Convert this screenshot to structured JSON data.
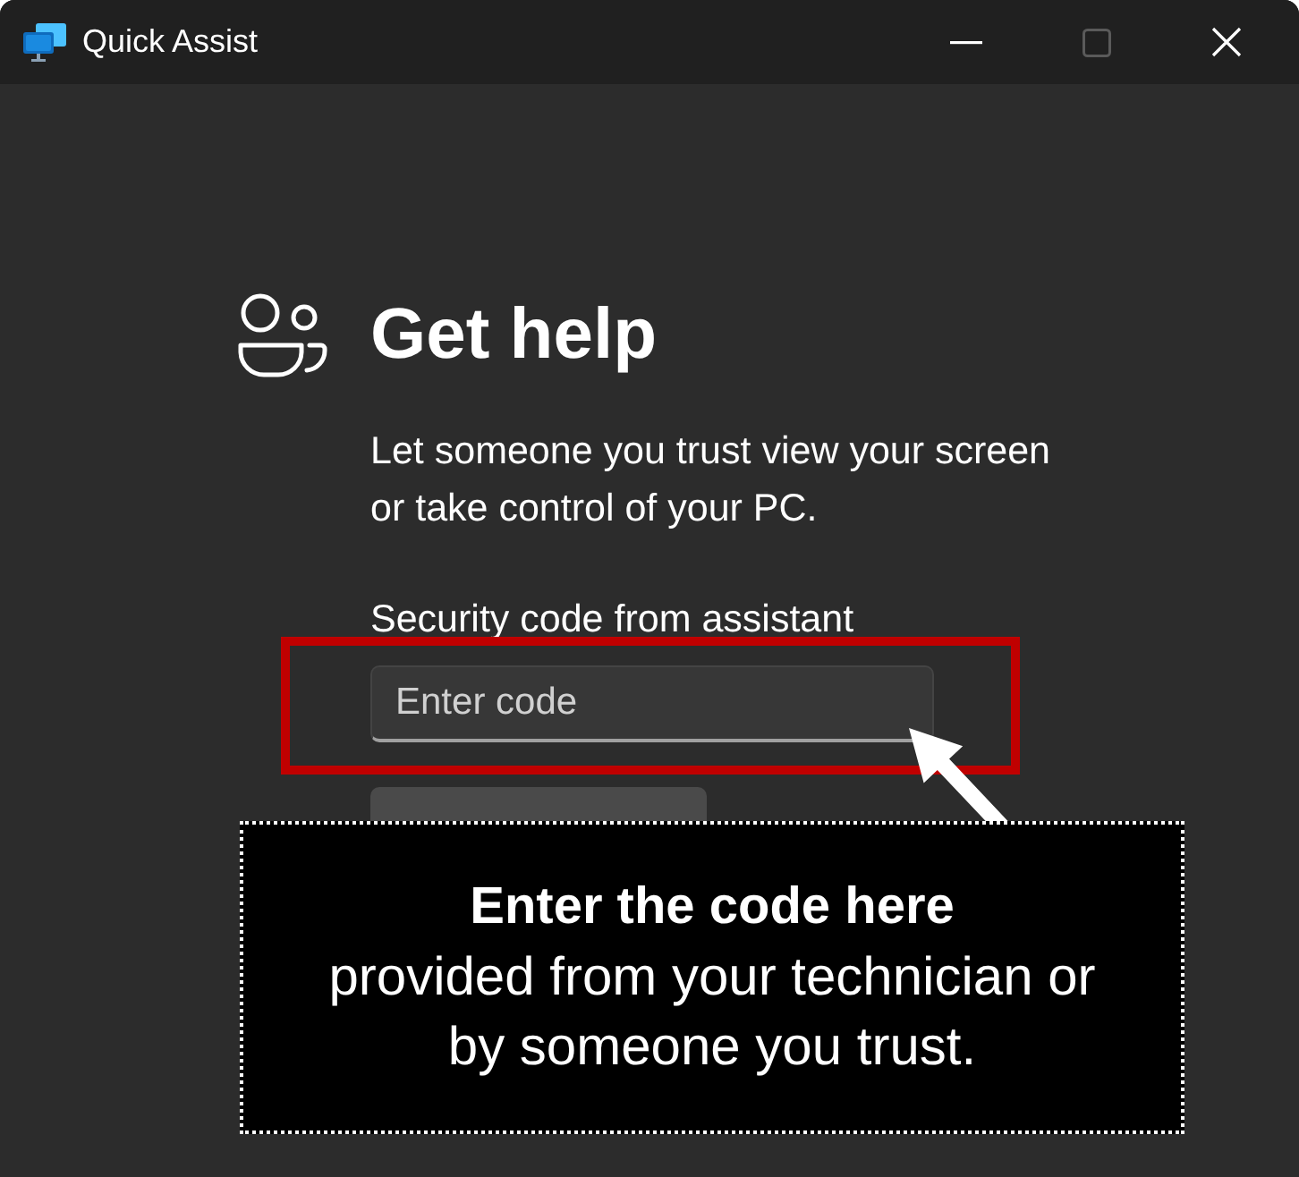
{
  "window": {
    "title": "Quick Assist",
    "maximize_disabled": true
  },
  "header": {
    "title": "Get help"
  },
  "description": "Let someone you trust view your screen or take control of your PC.",
  "code_field": {
    "label": "Security code from assistant",
    "placeholder": "Enter code"
  },
  "submit_button": {
    "disabled": true
  },
  "callout": {
    "heading": "Enter the code here",
    "text": "provided from your technician or\nby someone you trust."
  }
}
